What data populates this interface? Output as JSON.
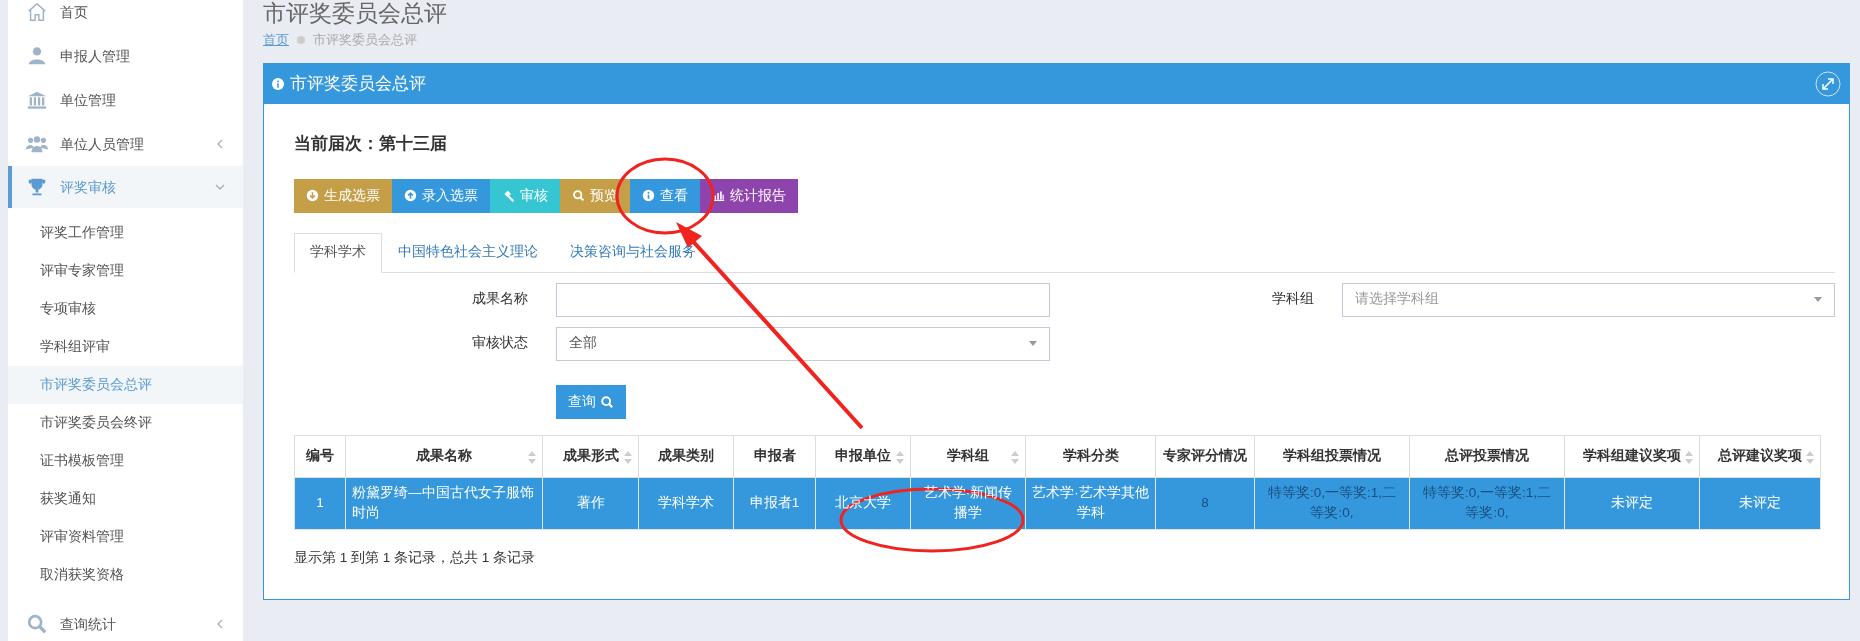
{
  "sidebar": {
    "items": [
      {
        "label": "首页",
        "selected": false
      },
      {
        "label": "申报人管理",
        "selected": false
      },
      {
        "label": "单位管理",
        "selected": false
      },
      {
        "label": "单位人员管理",
        "selected": false,
        "expanded": false
      },
      {
        "label": "评奖审核",
        "selected": true,
        "expanded": true,
        "children": [
          {
            "label": "评奖工作管理",
            "selected": false
          },
          {
            "label": "评审专家管理",
            "selected": false
          },
          {
            "label": "专项审核",
            "selected": false
          },
          {
            "label": "学科组评审",
            "selected": false
          },
          {
            "label": "市评奖委员会总评",
            "selected": true
          },
          {
            "label": "市评奖委员会终评",
            "selected": false
          },
          {
            "label": "证书模板管理",
            "selected": false
          },
          {
            "label": "获奖通知",
            "selected": false
          },
          {
            "label": "评审资料管理",
            "selected": false
          },
          {
            "label": "取消获奖资格",
            "selected": false
          }
        ]
      },
      {
        "label": "查询统计",
        "selected": false,
        "expanded": false
      }
    ]
  },
  "page": {
    "title": "市评奖委员会总评",
    "breadcrumb": [
      {
        "label": "首页"
      },
      {
        "label": "市评奖委员会总评"
      }
    ]
  },
  "panel": {
    "title": "市评奖委员会总评",
    "session": "当前届次：第十三届",
    "toolbar": [
      {
        "label": "生成选票",
        "color": "#c49f47"
      },
      {
        "label": "录入选票",
        "color": "#3598dc"
      },
      {
        "label": "审核",
        "color": "#36c6d3"
      },
      {
        "label": "预览",
        "color": "#c49f47"
      },
      {
        "label": "查看",
        "color": "#3598dc"
      },
      {
        "label": "统计报告",
        "color": "#8e44ad"
      }
    ],
    "tabs": [
      {
        "label": "学科学术",
        "selected": true
      },
      {
        "label": "中国特色社会主义理论",
        "selected": false
      },
      {
        "label": "决策咨询与社会服务",
        "selected": false
      }
    ],
    "filters": [
      {
        "kind": "text",
        "label": "成果名称"
      },
      {
        "kind": "select",
        "label": "学科组",
        "placeholder": "请选择学科组"
      },
      {
        "kind": "select",
        "label": "审核状态",
        "value": "全部"
      }
    ],
    "search_button": "查询",
    "table": {
      "columns": [
        {
          "label": "编号",
          "sortable": false,
          "link": false
        },
        {
          "label": "成果名称",
          "sortable": true,
          "link": false
        },
        {
          "label": "成果形式",
          "sortable": true,
          "link": false
        },
        {
          "label": "成果类别",
          "sortable": false,
          "link": false
        },
        {
          "label": "申报者",
          "sortable": false,
          "link": false
        },
        {
          "label": "申报单位",
          "sortable": true,
          "link": false
        },
        {
          "label": "学科组",
          "sortable": true,
          "link": false
        },
        {
          "label": "学科分类",
          "sortable": false,
          "link": false
        },
        {
          "label": "专家评分情况",
          "sortable": false,
          "link": true
        },
        {
          "label": "学科组投票情况",
          "sortable": false,
          "link": true
        },
        {
          "label": "总评投票情况",
          "sortable": false,
          "link": true
        },
        {
          "label": "学科组建议奖项",
          "sortable": true,
          "link": false
        },
        {
          "label": "总评建议奖项",
          "sortable": true,
          "link": false
        }
      ],
      "rows": [
        {
          "selected": true,
          "cells": [
            "1",
            "粉黛罗绮—中国古代女子服饰时尚",
            "著作",
            "学科学术",
            "申报者1",
            "北京大学",
            "艺术学·新闻传播学",
            "艺术学·艺术学其他学科",
            "8",
            "特等奖:0,一等奖:1,二等奖:0,",
            "特等奖:0,一等奖:1,二等奖:0,",
            "未评定",
            "未评定"
          ]
        }
      ]
    },
    "footer": "显示第 1 到第 1 条记录，总共 1 条记录"
  }
}
